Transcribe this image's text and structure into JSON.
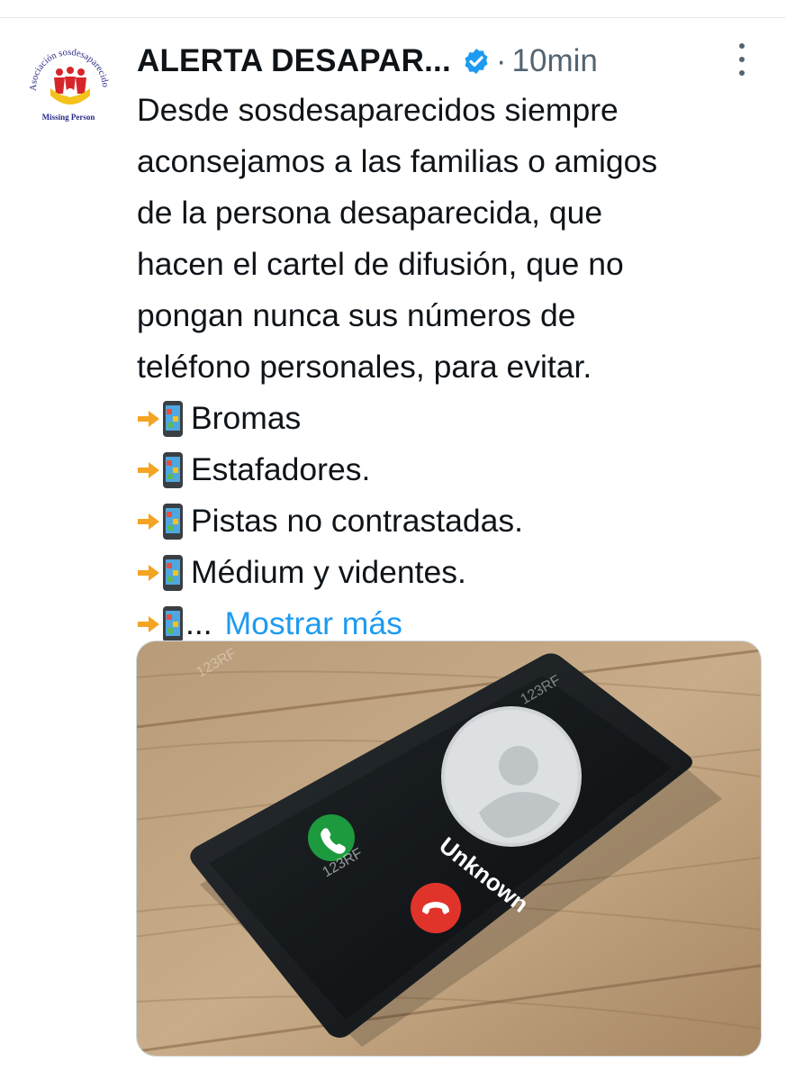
{
  "tweet": {
    "author_name": "ALERTA DESAPAR...",
    "separator": "·",
    "timestamp": "10min",
    "avatar": {
      "org_text_top": "Asociación sosdesaparecidos",
      "org_text_bottom": "Missing Person"
    },
    "text_lines": [
      "Desde sosdesaparecidos siempre",
      "aconsejamos a las familias o amigos",
      "de la  persona desaparecida, que",
      "hacen el cartel de difusión, que no",
      "pongan nunca sus números de",
      "teléfono personales, para evitar."
    ],
    "bullets": [
      "Bromas",
      "Estafadores.",
      "Pistas no contrastadas.",
      "Médium y videntes."
    ],
    "truncated_bullet": "...",
    "show_more": "Mostrar más",
    "media": {
      "caller_label": "Unknown",
      "watermark": "123RF"
    }
  },
  "colors": {
    "link": "#1d9bf0",
    "verified": "#1d9bf0",
    "text": "#0f1419",
    "muted": "#536471",
    "answer": "#1e9a3e",
    "decline": "#e0342b"
  },
  "icons": {
    "verified": "verified-badge-icon",
    "more": "more-dots-icon",
    "arrow": "right-arrow-icon",
    "phone": "mobile-phone-icon"
  }
}
